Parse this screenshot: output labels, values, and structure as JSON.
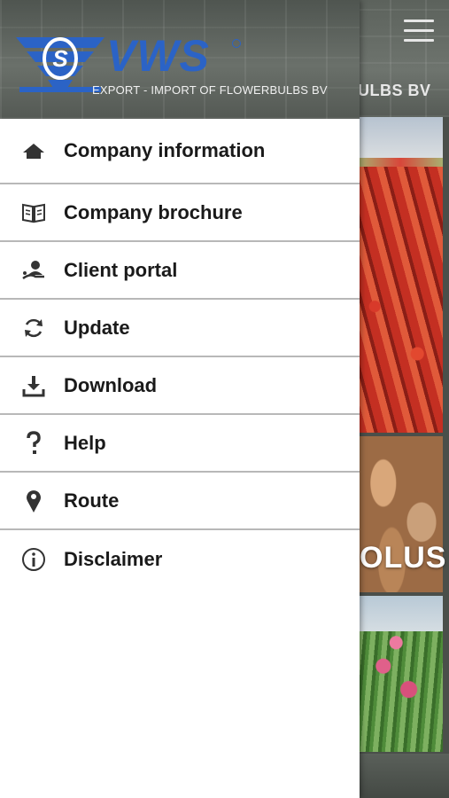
{
  "background": {
    "header_text": "ULBS BV",
    "tile_caption": "OLUS"
  },
  "drawer": {
    "brand": {
      "name": "VWS",
      "tagline": "EXPORT - IMPORT OF FLOWERBULBS BV",
      "color": "#2b63c6"
    },
    "menu": [
      {
        "label": "Company information",
        "icon": "home-icon"
      },
      {
        "label": "Company brochure",
        "icon": "brochure-icon"
      },
      {
        "label": "Client portal",
        "icon": "user-portal-icon"
      },
      {
        "label": "Update",
        "icon": "refresh-icon"
      },
      {
        "label": "Download",
        "icon": "download-icon"
      },
      {
        "label": "Help",
        "icon": "question-icon"
      },
      {
        "label": "Route",
        "icon": "map-pin-icon"
      },
      {
        "label": "Disclaimer",
        "icon": "info-icon"
      }
    ]
  }
}
